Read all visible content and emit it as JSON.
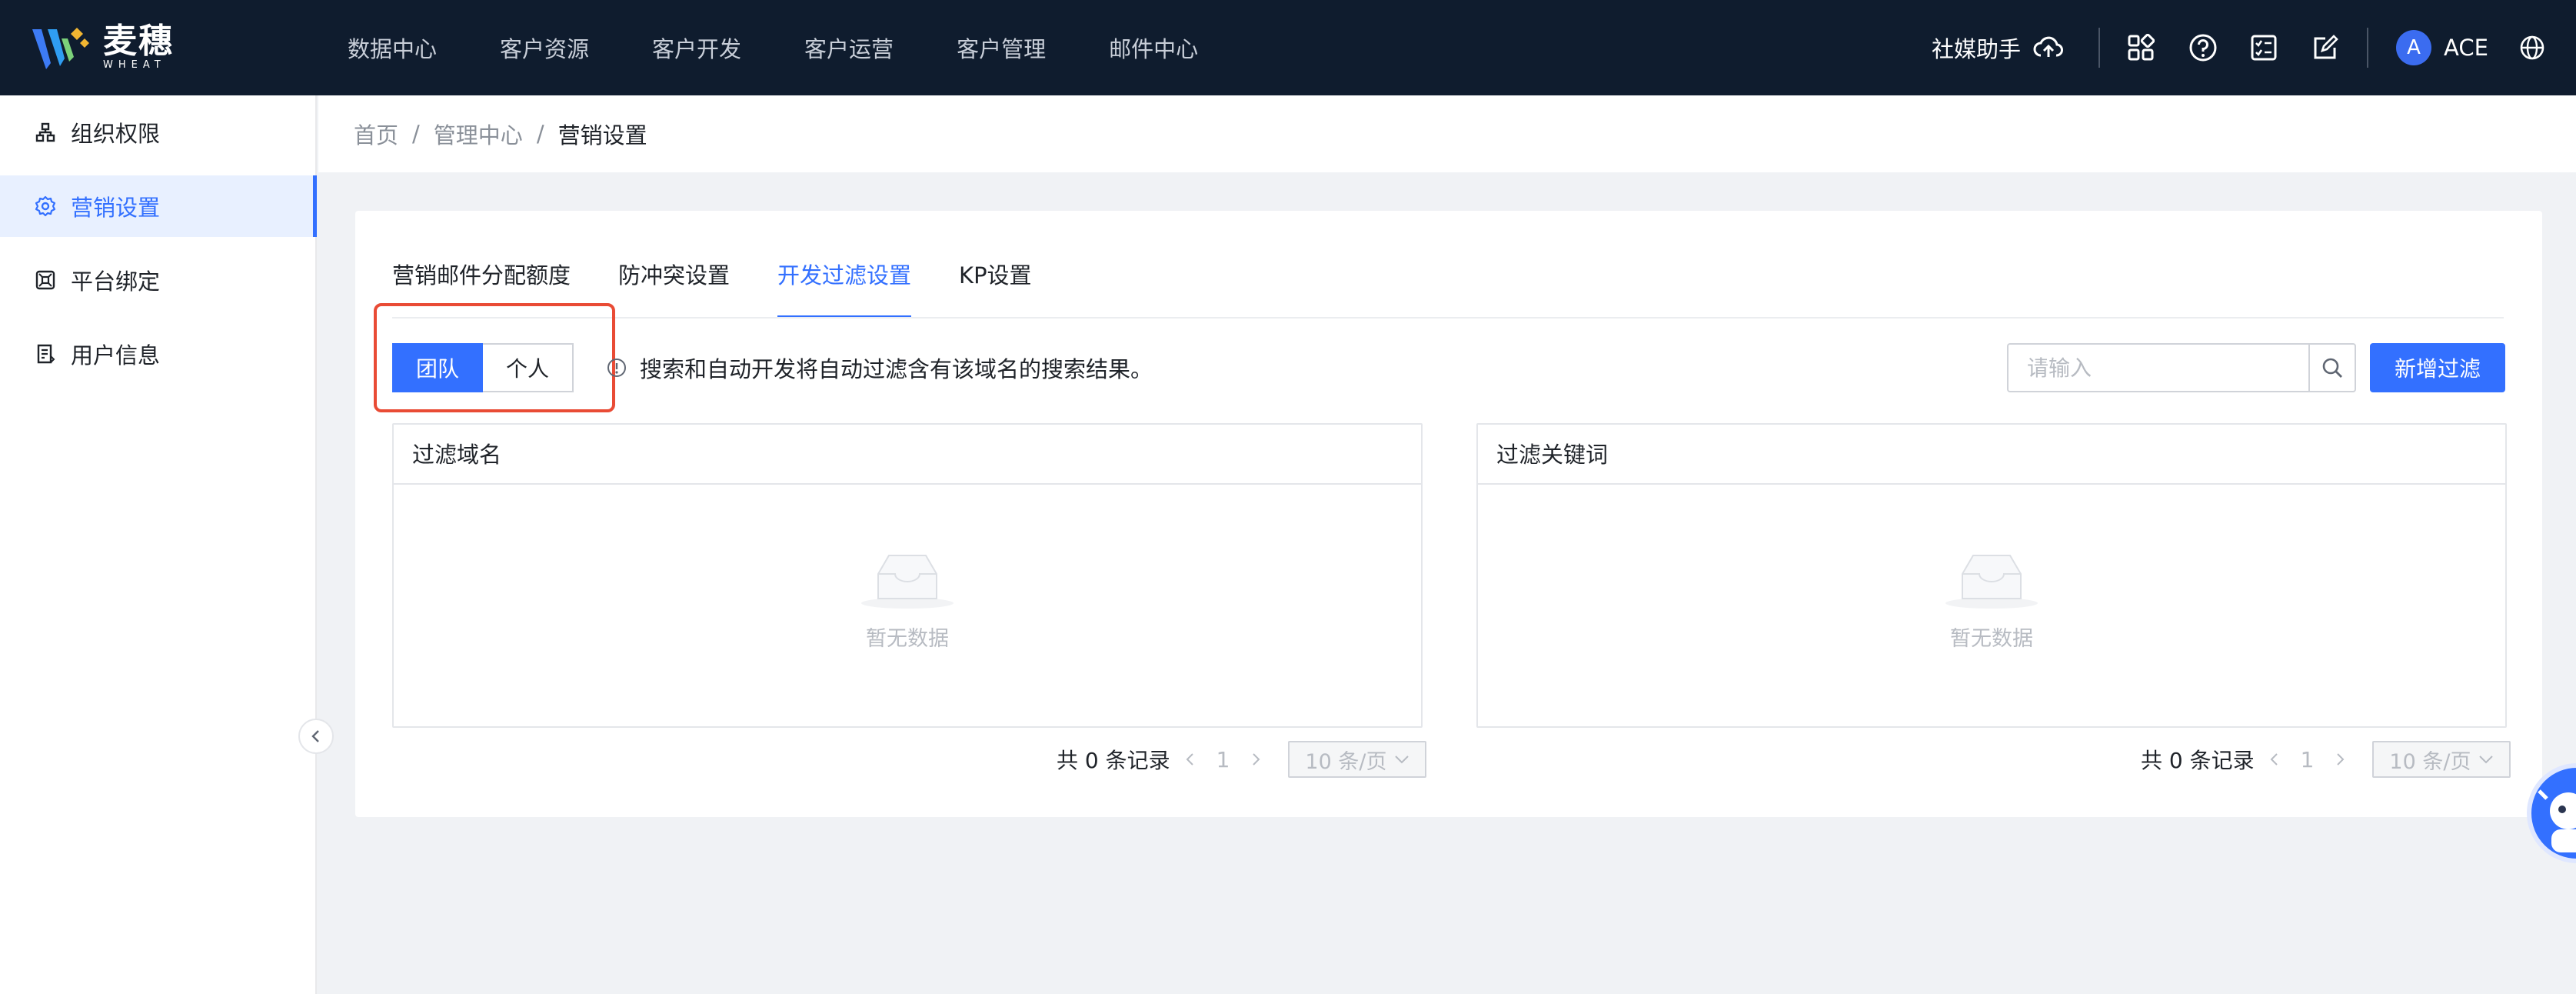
{
  "header": {
    "logo_cn": "麦穗",
    "logo_en": "WHEAT",
    "nav": [
      "数据中心",
      "客户资源",
      "客户开发",
      "客户运营",
      "客户管理",
      "邮件中心"
    ],
    "social_assistant": "社媒助手",
    "avatar_letter": "A",
    "username": "ACE"
  },
  "sidebar": {
    "items": [
      {
        "label": "组织权限",
        "icon": "org-tree-icon"
      },
      {
        "label": "营销设置",
        "icon": "gear-icon",
        "active": true
      },
      {
        "label": "平台绑定",
        "icon": "command-icon"
      },
      {
        "label": "用户信息",
        "icon": "user-doc-icon"
      }
    ]
  },
  "breadcrumb": [
    "首页",
    "管理中心",
    "营销设置"
  ],
  "tabs": [
    "营销邮件分配额度",
    "防冲突设置",
    "开发过滤设置",
    "KP设置"
  ],
  "active_tab": "开发过滤设置",
  "toggle": {
    "team": "团队",
    "personal": "个人",
    "selected": "团队"
  },
  "tip": "搜索和自动开发将自动过滤含有该域名的搜索结果。",
  "search": {
    "placeholder": "请输入",
    "value": ""
  },
  "add_button": "新增过滤",
  "panels": [
    {
      "title": "过滤域名",
      "empty_text": "暂无数据",
      "pager": {
        "total_text": "共 0 条记录",
        "page": "1",
        "page_size": "10 条/页"
      }
    },
    {
      "title": "过滤关键词",
      "empty_text": "暂无数据",
      "pager": {
        "total_text": "共 0 条记录",
        "page": "1",
        "page_size": "10 条/页"
      }
    }
  ],
  "colors": {
    "topbar": "#0f1c2e",
    "primary": "#3370ff",
    "highlight": "#e94b35"
  }
}
